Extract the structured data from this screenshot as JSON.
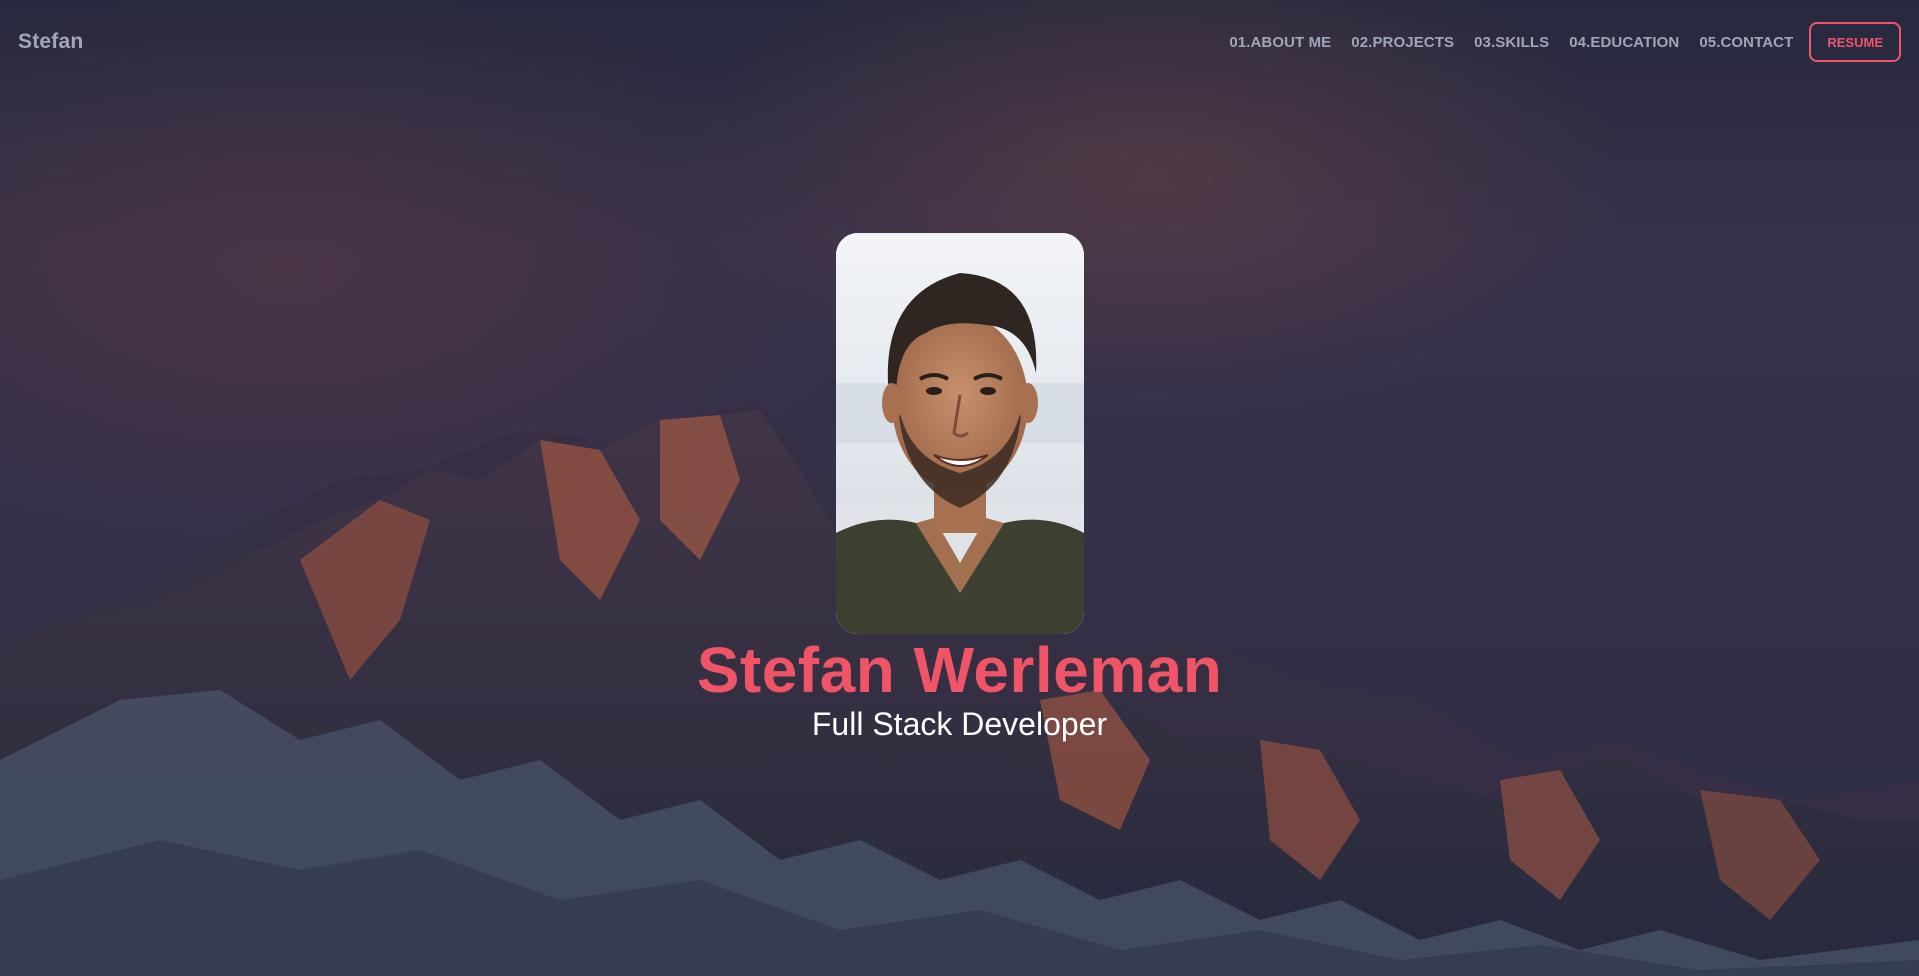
{
  "nav": {
    "brand": "Stefan",
    "links": [
      {
        "label": "01.ABOUT ME"
      },
      {
        "label": "02.PROJECTS"
      },
      {
        "label": "03.SKILLS"
      },
      {
        "label": "04.EDUCATION"
      },
      {
        "label": "05.CONTACT"
      }
    ],
    "resume_label": "RESUME"
  },
  "hero": {
    "name": "Stefan Werleman",
    "role": "Full Stack Developer",
    "background": "mountain-range-at-sunset-image",
    "portrait": "profile-photo-image"
  },
  "colors": {
    "accent": "#ef5467",
    "nav_text": "#a2a5b7",
    "background": "#2c2d44",
    "role_text": "#ffffff"
  }
}
